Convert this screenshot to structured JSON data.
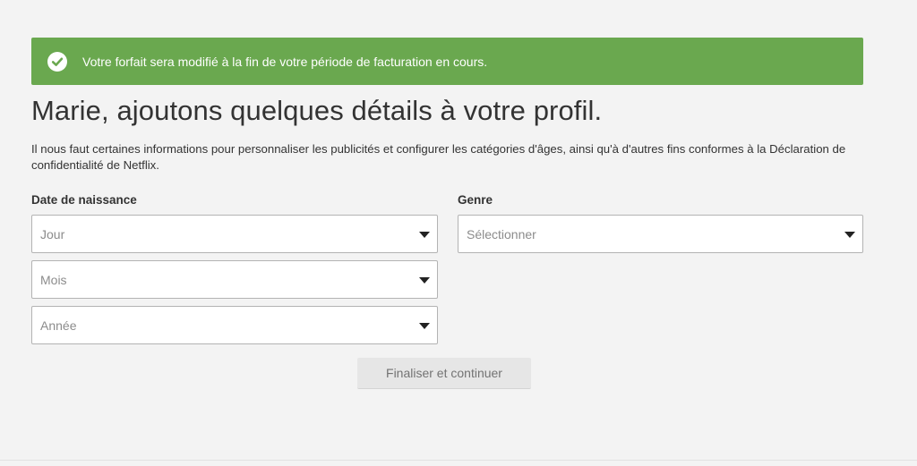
{
  "banner": {
    "message": "Votre forfait sera modifié à la fin de votre période de facturation en cours.",
    "icon": "check-circle-icon",
    "color": "#6aa84f"
  },
  "page": {
    "title": "Marie, ajoutons quelques détails à votre profil.",
    "description": "Il nous faut certaines informations pour personnaliser les publicités et configurer les catégories d'âges, ainsi qu'à d'autres fins conformes à la Déclaration de confidentialité de Netflix."
  },
  "form": {
    "birthdate": {
      "label": "Date de naissance",
      "day_placeholder": "Jour",
      "month_placeholder": "Mois",
      "year_placeholder": "Année"
    },
    "gender": {
      "label": "Genre",
      "placeholder": "Sélectionner"
    },
    "submit_label": "Finaliser et continuer"
  }
}
